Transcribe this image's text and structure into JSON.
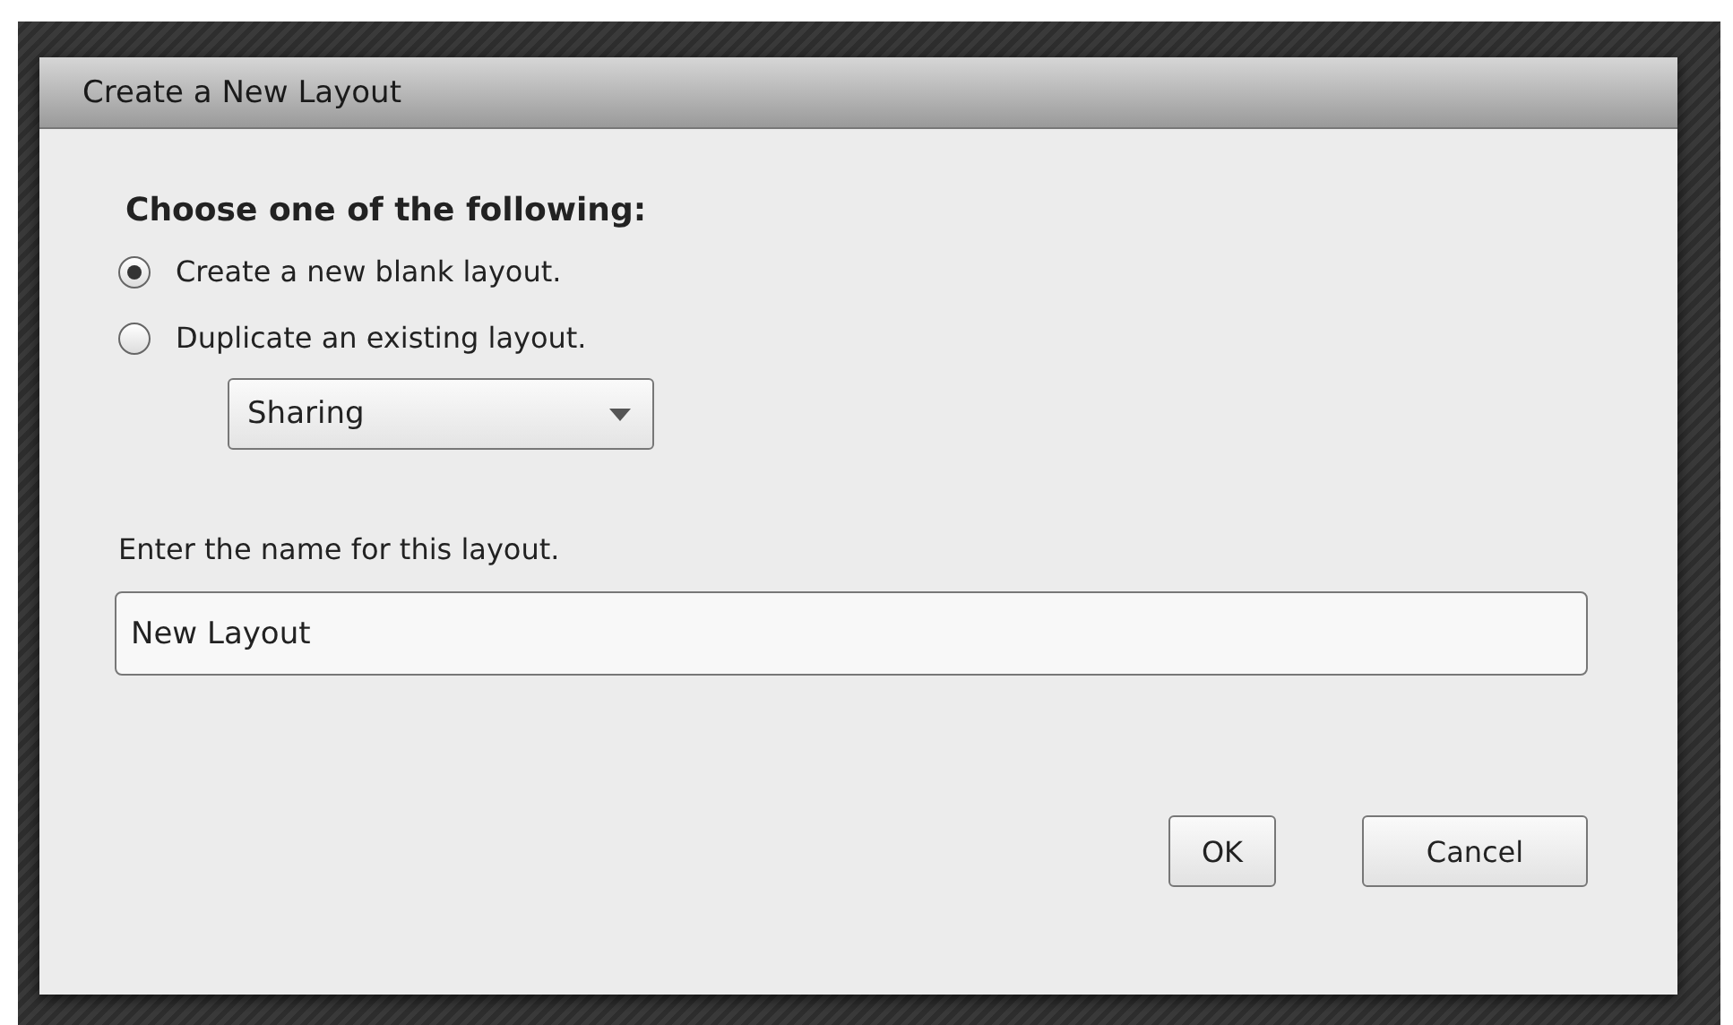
{
  "dialog": {
    "title": "Create a New Layout",
    "heading": "Choose one of the following:",
    "options": [
      {
        "label": "Create a new blank layout.",
        "selected": true
      },
      {
        "label": "Duplicate an existing layout.",
        "selected": false
      }
    ],
    "layout_select": {
      "value": "Sharing"
    },
    "name_label": "Enter the name for this layout.",
    "name_field": {
      "value": "New Layout"
    },
    "buttons": [
      "OK",
      "Cancel"
    ]
  }
}
